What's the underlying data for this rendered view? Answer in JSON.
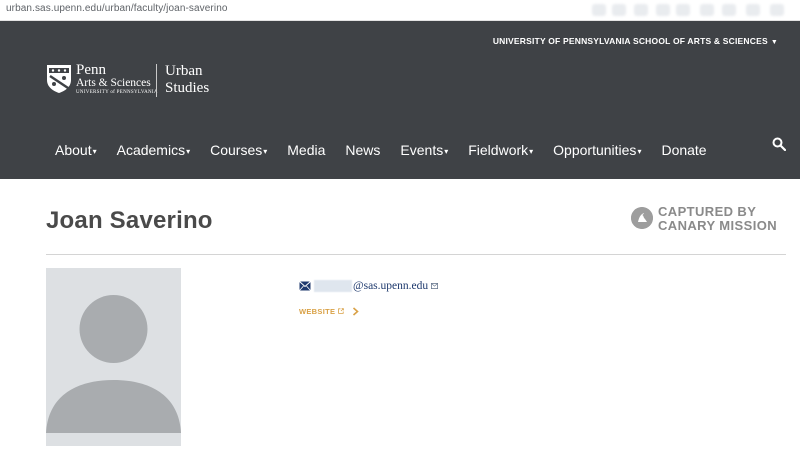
{
  "browser": {
    "url": "urban.sas.upenn.edu/urban/faculty/joan-saverino"
  },
  "header": {
    "school_link": "UNIVERSITY OF PENNSYLVANIA SCHOOL OF ARTS & SCIENCES",
    "logo": {
      "penn": "Penn",
      "arts": "Arts & Sciences",
      "university": "UNIVERSITY of PENNSYLVANIA",
      "dept_line1": "Urban",
      "dept_line2": "Studies"
    },
    "nav": [
      {
        "label": "About",
        "dropdown": true
      },
      {
        "label": "Academics",
        "dropdown": true
      },
      {
        "label": "Courses",
        "dropdown": true
      },
      {
        "label": "Media",
        "dropdown": false
      },
      {
        "label": "News",
        "dropdown": false
      },
      {
        "label": "Events",
        "dropdown": true
      },
      {
        "label": "Fieldwork",
        "dropdown": true
      },
      {
        "label": "Opportunities",
        "dropdown": true
      },
      {
        "label": "Donate",
        "dropdown": false
      }
    ],
    "colors": {
      "background": "#3f4246",
      "text": "#ffffff"
    }
  },
  "profile": {
    "name": "Joan Saverino",
    "email_domain": "@sas.upenn.edu",
    "website_label": "WEBSITE",
    "accent": "#d9a146"
  },
  "overlay": {
    "line1": "CAPTURED BY",
    "line2": "CANARY MISSION"
  }
}
